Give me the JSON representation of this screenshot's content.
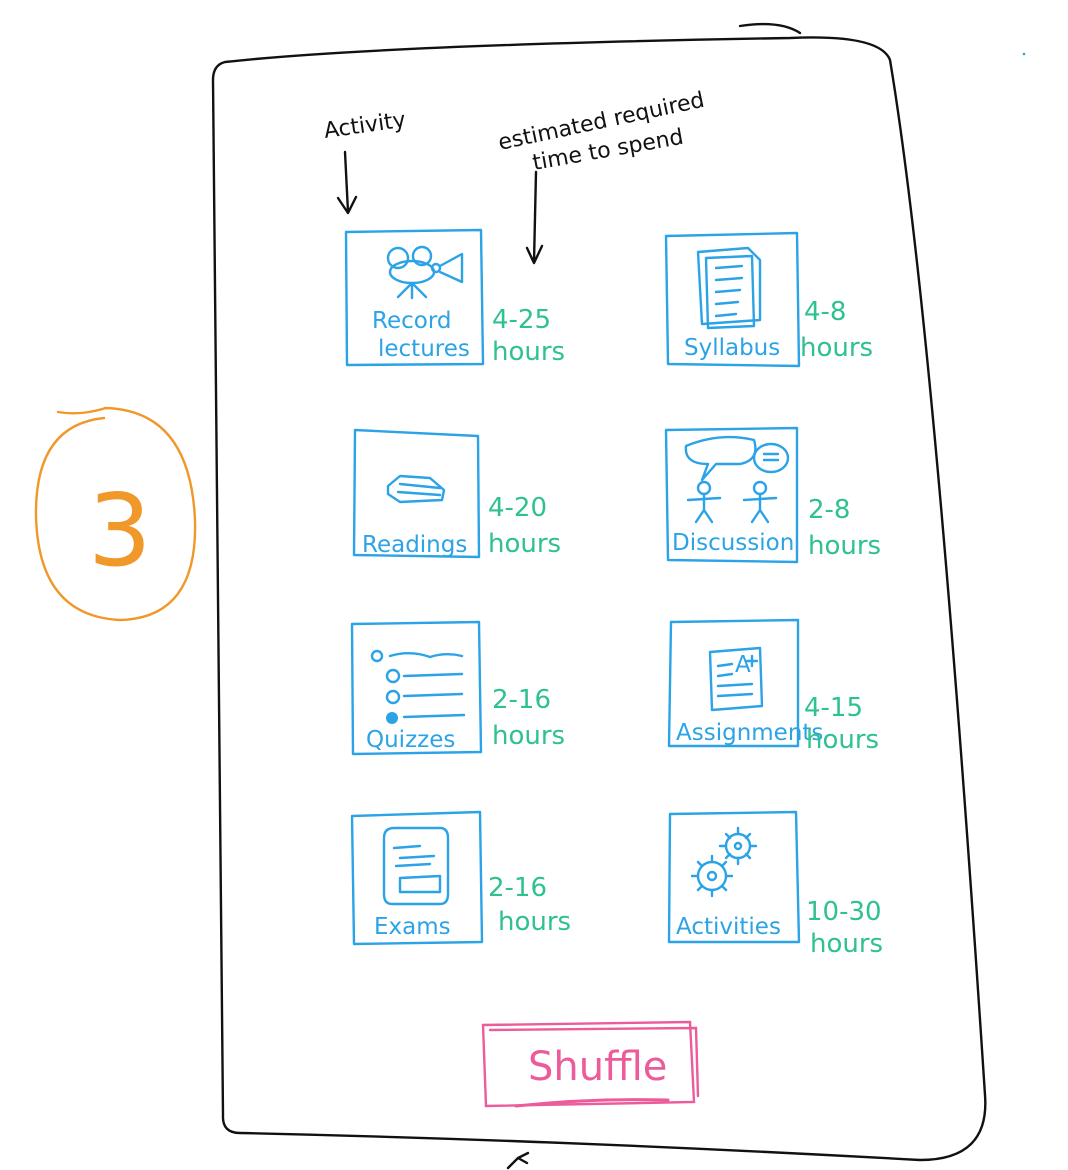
{
  "step_number": "3",
  "annotations": {
    "activity": "Activity",
    "estimated_line1": "estimated required",
    "estimated_line2": "time to spend"
  },
  "tiles": [
    {
      "label1": "Record",
      "label2": "lectures",
      "hours1": "4-25",
      "hours2": "hours",
      "icon": "video-camera-icon"
    },
    {
      "label1": "Syllabus",
      "label2": "",
      "hours1": "4-8",
      "hours2": "hours",
      "icon": "document-icon"
    },
    {
      "label1": "Readings",
      "label2": "",
      "hours1": "4-20",
      "hours2": "hours",
      "icon": "book-icon"
    },
    {
      "label1": "Discussion",
      "label2": "",
      "hours1": "2-8",
      "hours2": "hours",
      "icon": "discussion-icon"
    },
    {
      "label1": "Quizzes",
      "label2": "",
      "hours1": "2-16",
      "hours2": "hours",
      "icon": "quiz-icon"
    },
    {
      "label1": "Assignments",
      "label2": "",
      "hours1": "4-15",
      "hours2": "hours",
      "icon": "graded-paper-icon"
    },
    {
      "label1": "Exams",
      "label2": "",
      "hours1": "2-16",
      "hours2": "hours",
      "icon": "exam-paper-icon"
    },
    {
      "label1": "Activities",
      "label2": "",
      "hours1": "10-30",
      "hours2": "hours",
      "icon": "gears-icon"
    }
  ],
  "shuffle_label": "Shuffle",
  "colors": {
    "tile": "#2ba3e6",
    "hours": "#2fc190",
    "shuffle": "#ec5b9a",
    "step": "#f0982a",
    "ink": "#111111"
  }
}
